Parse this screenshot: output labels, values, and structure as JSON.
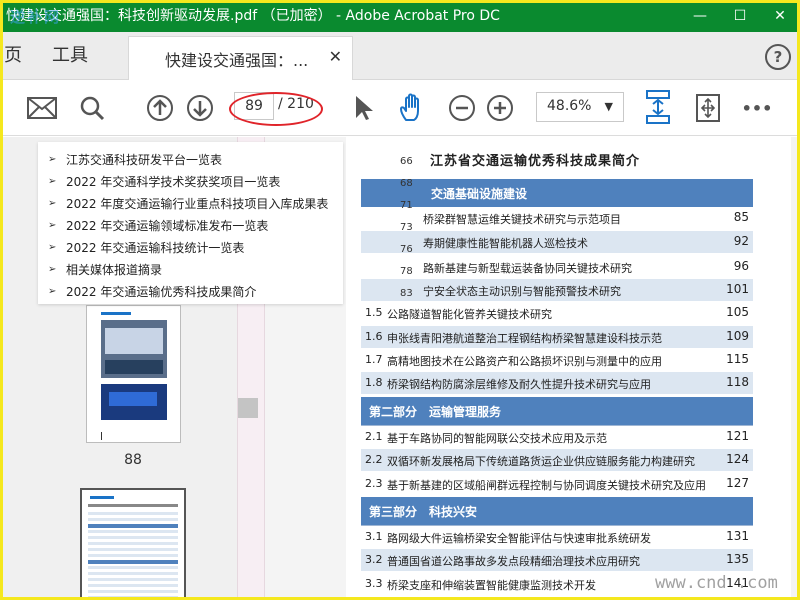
{
  "window": {
    "title": "快建设交通强国：科技创新驱动发展.pdf （已加密） - Adobe Acrobat Pro DC",
    "watermark": "逆补网",
    "minimize": "—",
    "maximize": "☐",
    "close": "✕"
  },
  "menu": {
    "home": "页",
    "tools": "工具"
  },
  "tab": {
    "label": "快建设交通强国：...",
    "close": "✕"
  },
  "help": "?",
  "toolbar": {
    "page_current": "89",
    "page_total": "/ 210",
    "zoom": "48.6%",
    "zoom_caret": "▼",
    "more": "•••"
  },
  "thumbnails": {
    "page_label": "88"
  },
  "bookmarks": [
    "江苏交通科技研发平台一览表",
    "2022 年交通科学技术奖获奖项目一览表",
    "2022 年度交通运输行业重点科技项目入库成果表",
    "2022 年交通运输领域标准发布一览表",
    "2022 年交通运输科技统计一览表",
    "相关媒体报道摘录",
    "2022 年交通运输优秀科技成果简介"
  ],
  "bookmark_arrow": "➢",
  "left_numbers": [
    "66",
    "68",
    "71",
    "73",
    "76",
    "78",
    "83"
  ],
  "document": {
    "title": "江苏省交通运输优秀科技成果简介",
    "sections": [
      {
        "title": "交通基础设施建设",
        "items": [
          {
            "num": "",
            "text": "桥梁群智慧运维关键技术研究与示范项目",
            "page": "85"
          },
          {
            "num": "",
            "text": "寿期健康性能智能机器人巡检技术",
            "page": "92"
          },
          {
            "num": "",
            "text": "路新基建与新型载运装备协同关键技术研究",
            "page": "96"
          },
          {
            "num": "",
            "text": "宁安全状态主动识别与智能预警技术研究",
            "page": "101"
          },
          {
            "num": "1.5",
            "text": "公路隧道智能化管养关键技术研究",
            "page": "105"
          },
          {
            "num": "1.6",
            "text": "申张线青阳港航道整治工程钢结构桥梁智慧建设科技示范",
            "page": "109"
          },
          {
            "num": "1.7",
            "text": "高精地图技术在公路资产和公路损坏识别与测量中的应用",
            "page": "115"
          },
          {
            "num": "1.8",
            "text": "桥梁钢结构防腐涂层维修及耐久性提升技术研究与应用",
            "page": "118"
          }
        ]
      },
      {
        "title": "第二部分　运输管理服务",
        "items": [
          {
            "num": "2.1",
            "text": "基于车路协同的智能网联公交技术应用及示范",
            "page": "121"
          },
          {
            "num": "2.2",
            "text": "双循环新发展格局下传统道路货运企业供应链服务能力构建研究",
            "page": "124"
          },
          {
            "num": "2.3",
            "text": "基于新基建的区域船闸群远程控制与协同调度关键技术研究及应用",
            "page": "127"
          }
        ]
      },
      {
        "title": "第三部分　科技兴安",
        "items": [
          {
            "num": "3.1",
            "text": "路网级大件运输桥梁安全智能评估与快速审批系统研发",
            "page": "131"
          },
          {
            "num": "3.2",
            "text": "普通国省道公路事故多发点段精细治理技术应用研究",
            "page": "135"
          },
          {
            "num": "3.3",
            "text": "桥梁支座和伸缩装置智能健康监测技术开发",
            "page": "141"
          }
        ]
      }
    ]
  },
  "site_watermark": "www.cnd   .com",
  "colors": {
    "titlebar": "#0a8a2f",
    "section": "#4f81bd",
    "row_alt": "#dce6f1",
    "highlight": "#e0242a",
    "accent_blue": "#1a73c7"
  }
}
